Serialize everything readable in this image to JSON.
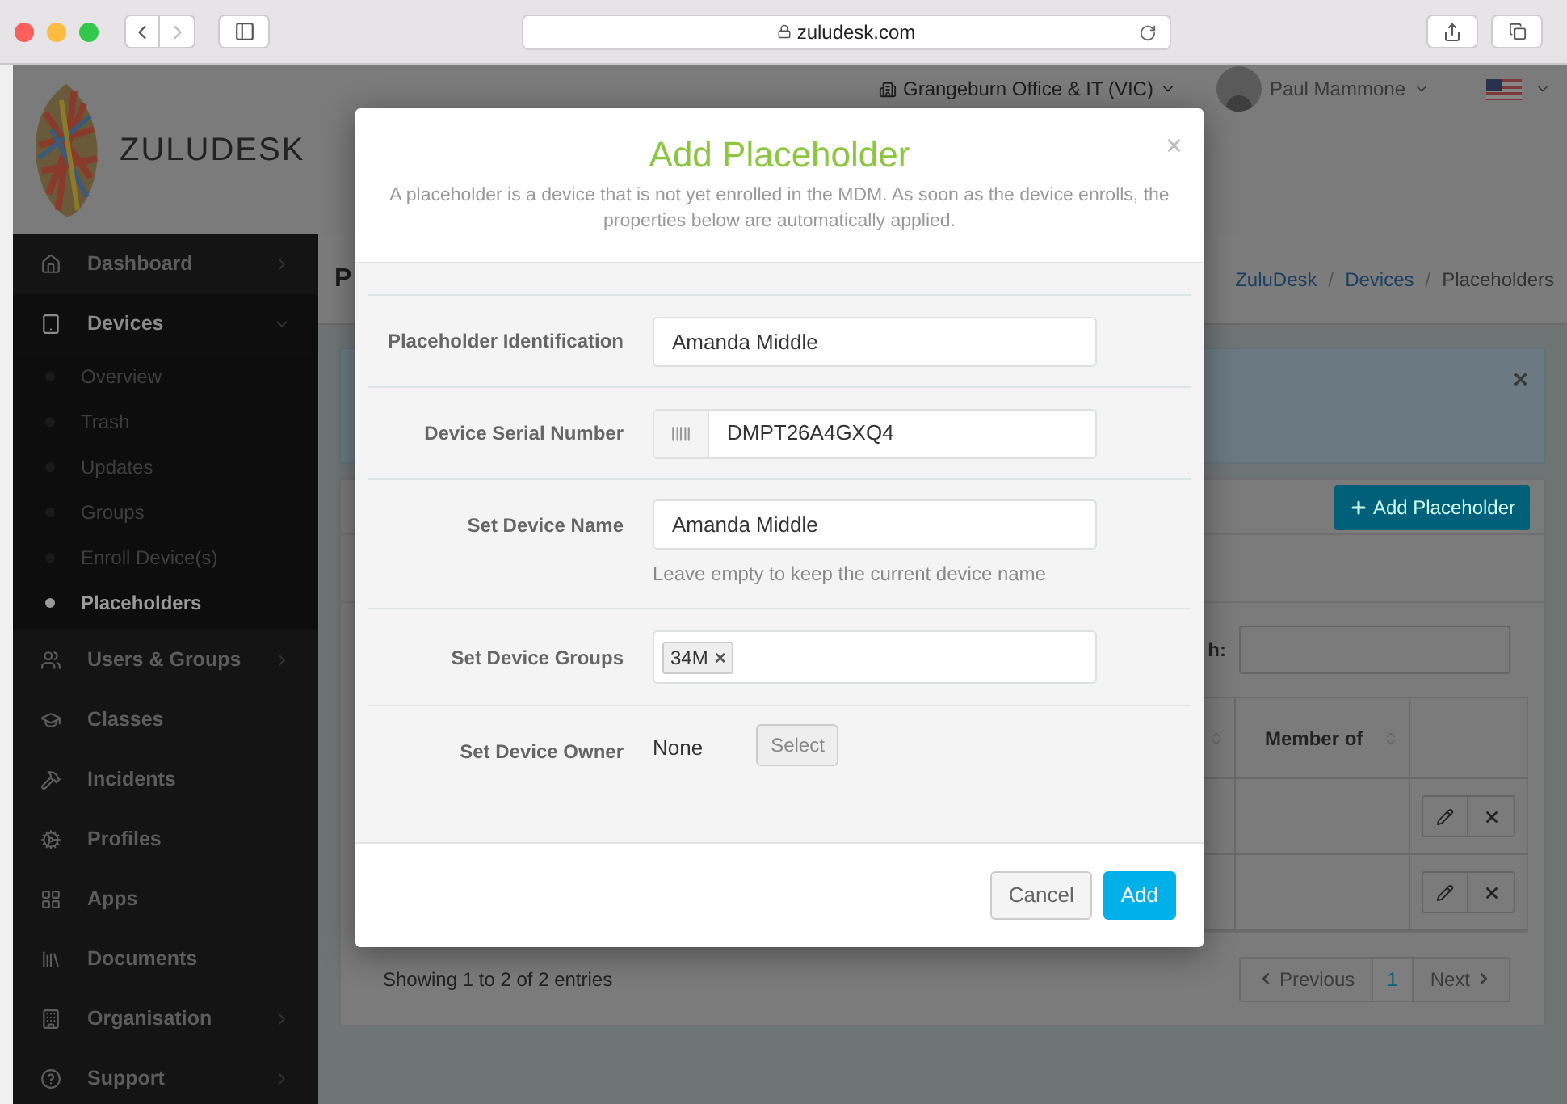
{
  "browser": {
    "address": "zuludesk.com"
  },
  "header": {
    "logo_text": "ZULUDESK",
    "location": "Grangeburn Office & IT (VIC)",
    "user": "Paul Mammone"
  },
  "sidebar": {
    "items": [
      {
        "label": "Dashboard",
        "expandable": true,
        "expanded": false
      },
      {
        "label": "Devices",
        "expandable": true,
        "expanded": true,
        "children": [
          {
            "label": "Overview",
            "selected": false
          },
          {
            "label": "Trash",
            "selected": false
          },
          {
            "label": "Updates",
            "selected": false
          },
          {
            "label": "Groups",
            "selected": false
          },
          {
            "label": "Enroll Device(s)",
            "selected": false
          },
          {
            "label": "Placeholders",
            "selected": true
          }
        ]
      },
      {
        "label": "Users & Groups",
        "expandable": true,
        "expanded": false
      },
      {
        "label": "Classes",
        "expandable": false,
        "expanded": false
      },
      {
        "label": "Incidents",
        "expandable": false,
        "expanded": false
      },
      {
        "label": "Profiles",
        "expandable": false,
        "expanded": false
      },
      {
        "label": "Apps",
        "expandable": false,
        "expanded": false
      },
      {
        "label": "Documents",
        "expandable": false,
        "expanded": false
      },
      {
        "label": "Organisation",
        "expandable": true,
        "expanded": false
      },
      {
        "label": "Support",
        "expandable": true,
        "expanded": false
      }
    ]
  },
  "page": {
    "title": "P",
    "breadcrumb": {
      "separator": "/",
      "items": [
        {
          "label": "ZuluDesk",
          "link": true
        },
        {
          "label": "Devices",
          "link": true
        },
        {
          "label": "Placeholders",
          "link": false
        }
      ]
    },
    "alert_close": "×",
    "add_button": "Add Placeholder",
    "search_label": "h:",
    "table": {
      "columns": [
        {
          "label": "Member of",
          "sortable": true
        }
      ],
      "rows": [
        {
          "editable": true,
          "deletable": true
        },
        {
          "editable": true,
          "deletable": true
        }
      ]
    },
    "info": "Showing 1 to 2 of 2 entries",
    "pagination": {
      "previous": "Previous",
      "next": "Next",
      "pages": [
        {
          "label": "1",
          "selected": true
        }
      ]
    }
  },
  "modal": {
    "title": "Add Placeholder",
    "close": "×",
    "description": "A placeholder is a device that is not yet enrolled in the MDM. As soon as the device enrolls, the properties below are automatically applied.",
    "fields": [
      {
        "kind": "text",
        "label": "Placeholder Identification",
        "value": "Amanda Middle"
      },
      {
        "kind": "serial",
        "label": "Device Serial Number",
        "value": "DMPT26A4GXQ4"
      },
      {
        "kind": "text",
        "label": "Set Device Name",
        "value": "Amanda Middle",
        "help": "Leave empty to keep the current device name"
      },
      {
        "kind": "tags",
        "label": "Set Device Groups",
        "tags": [
          "34M"
        ],
        "remove": "×"
      },
      {
        "kind": "owner",
        "label": "Set Device Owner",
        "value": "None",
        "button": "Select"
      }
    ],
    "buttons": [
      {
        "label": "Cancel",
        "kind": "default"
      },
      {
        "label": "Add",
        "kind": "primary"
      }
    ]
  }
}
